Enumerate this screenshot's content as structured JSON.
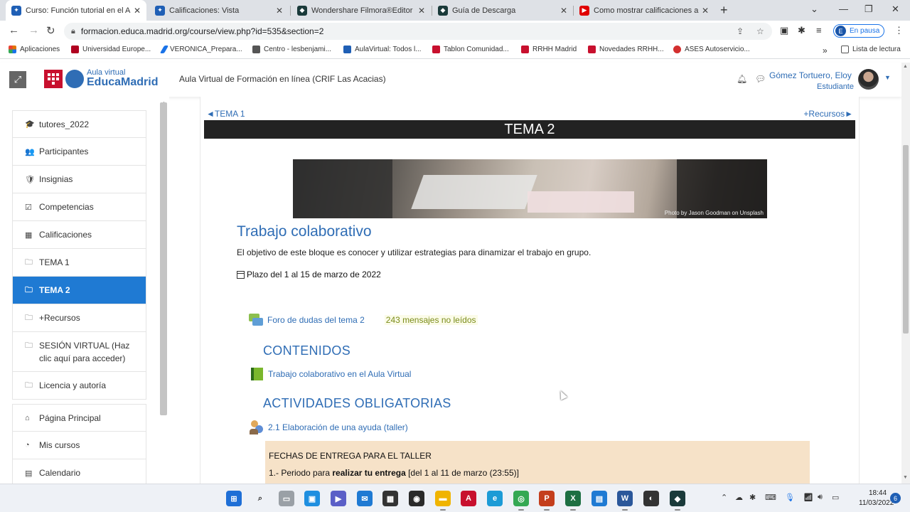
{
  "browser": {
    "tabs": [
      {
        "label": "Curso: Función tutorial en el Aula",
        "color": "#1f5fb5",
        "icon": "moodle-cap-icon",
        "active": true
      },
      {
        "label": "Calificaciones: Vista",
        "color": "#1f5fb5",
        "icon": "moodle-cap-icon",
        "active": false
      },
      {
        "label": "Wondershare Filmora®Editor de",
        "color": "#1a3a3a",
        "icon": "filmora-icon",
        "active": false
      },
      {
        "label": "Guía de Descarga",
        "color": "#1a3a3a",
        "icon": "filmora-icon",
        "active": false
      },
      {
        "label": "Como mostrar calificaciones a lo",
        "color": "#e00000",
        "icon": "youtube-icon",
        "active": false
      }
    ],
    "url": "formacion.educa.madrid.org/course/view.php?id=535&section=2",
    "profile_initial": "E",
    "profile_label": "En pausa",
    "bookmarks": [
      {
        "label": "Aplicaciones",
        "icon": "apps-grid-icon",
        "color": "#e37400"
      },
      {
        "label": "Universidad Europe...",
        "icon": "ue-icon",
        "color": "#b00020"
      },
      {
        "label": "VERONICA_Prepara...",
        "icon": "pen-icon",
        "color": "#1a73e8"
      },
      {
        "label": "Centro - lesbenjami...",
        "icon": "building-icon",
        "color": "#555555"
      },
      {
        "label": "AulaVirtual: Todos l...",
        "icon": "moodle-cap-icon",
        "color": "#1f5fb5"
      },
      {
        "label": "Tablon Comunidad...",
        "icon": "madrid-icon",
        "color": "#c8102e"
      },
      {
        "label": "RRHH Madrid",
        "icon": "madrid-icon",
        "color": "#c8102e"
      },
      {
        "label": "Novedades RRHH...",
        "icon": "madrid-icon",
        "color": "#c8102e"
      },
      {
        "label": "ASES Autoservicio...",
        "icon": "ases-icon",
        "color": "#d32f2f"
      }
    ],
    "more_bookmarks": "»",
    "reading_list": "Lista de lectura"
  },
  "header": {
    "logo_line1": "Aula virtual",
    "logo_line2": "EducaMadrid",
    "site_title": "Aula Virtual de Formación en línea (CRIF Las Acacias)",
    "user_name": "Gómez Tortuero, Eloy",
    "user_role": "Estudiante"
  },
  "sidebar": {
    "items": [
      {
        "label": "tutores_2022",
        "icon": "graduation-cap-icon",
        "glyph": "🎓"
      },
      {
        "label": "Participantes",
        "icon": "users-icon",
        "glyph": "👥"
      },
      {
        "label": "Insignias",
        "icon": "shield-icon",
        "glyph": "🛡"
      },
      {
        "label": "Competencias",
        "icon": "check-square-icon",
        "glyph": "☑"
      },
      {
        "label": "Calificaciones",
        "icon": "table-icon",
        "glyph": "▦"
      },
      {
        "label": "TEMA 1",
        "icon": "folder-icon",
        "glyph": "🗀"
      },
      {
        "label": "TEMA 2",
        "icon": "folder-icon",
        "glyph": "🗀",
        "active": true
      },
      {
        "label": "+Recursos",
        "icon": "folder-icon",
        "glyph": "🗀"
      },
      {
        "label": "SESIÓN VIRTUAL (Haz clic aquí para acceder)",
        "icon": "folder-icon",
        "glyph": "🗀"
      },
      {
        "label": "Licencia y autoría",
        "icon": "folder-icon",
        "glyph": "🗀"
      }
    ],
    "items2": [
      {
        "label": "Página Principal",
        "icon": "home-icon",
        "glyph": "⌂"
      },
      {
        "label": "Mis cursos",
        "icon": "tachometer-icon",
        "glyph": "◔"
      },
      {
        "label": "Calendario",
        "icon": "calendar-icon",
        "glyph": "▤"
      }
    ]
  },
  "main": {
    "prev_link": "◄TEMA 1",
    "next_link": "+Recursos►",
    "section_title": "TEMA 2",
    "banner_credit": "Photo by Jason Goodman on Unsplash",
    "block_title": "Trabajo colaborativo",
    "block_description": "El objetivo de este bloque es conocer y utilizar estrategias para dinamizar el trabajo en grupo.",
    "deadline": "Plazo del 1 al 15 de marzo de 2022",
    "forum_link": "Foro de dudas del tema 2",
    "forum_unread": "243 mensajes no leídos",
    "contenidos_heading": "CONTENIDOS",
    "book_link": "Trabajo colaborativo en el Aula Virtual",
    "actividades_heading": "ACTIVIDADES OBLIGATORIAS",
    "workshop_link": "2.1 Elaboración de una ayuda (taller)",
    "notice_title": "FECHAS DE ENTREGA PARA EL TALLER",
    "notice_line1_prefix": "1.- Periodo para ",
    "notice_line1_bold": "realizar tu entrega",
    "notice_line1_suffix": " [del 1 al 11 de marzo (23:55)]"
  },
  "taskbar": {
    "apps": [
      {
        "name": "windows-start-icon",
        "color": "#1f6fd6",
        "glyph": "⊞"
      },
      {
        "name": "search-icon",
        "color": "#eef1f6",
        "glyph": "⌕"
      },
      {
        "name": "task-view-icon",
        "color": "#9aa0a6",
        "glyph": "▭"
      },
      {
        "name": "widgets-icon",
        "color": "#1f8fe0",
        "glyph": "▣"
      },
      {
        "name": "teams-chat-icon",
        "color": "#5b5fc7",
        "glyph": "▶"
      },
      {
        "name": "mail-icon",
        "color": "#1f7ad3",
        "glyph": "✉"
      },
      {
        "name": "store-icon",
        "color": "#333333",
        "glyph": "▦"
      },
      {
        "name": "obs-icon",
        "color": "#2a2a2a",
        "glyph": "◉"
      },
      {
        "name": "file-explorer-icon",
        "color": "#f0b400",
        "glyph": "▬"
      },
      {
        "name": "acrobat-icon",
        "color": "#c8102e",
        "glyph": "A"
      },
      {
        "name": "edge-icon",
        "color": "#1c9bd6",
        "glyph": "e"
      },
      {
        "name": "chrome-icon",
        "color": "#34a853",
        "glyph": "◎"
      },
      {
        "name": "powerpoint-icon",
        "color": "#c43e1c",
        "glyph": "P"
      },
      {
        "name": "excel-icon",
        "color": "#1d6f42",
        "glyph": "X"
      },
      {
        "name": "calculator-icon",
        "color": "#1f7ad3",
        "glyph": "▤"
      },
      {
        "name": "word-icon",
        "color": "#2b579a",
        "glyph": "W"
      },
      {
        "name": "obs-studio-icon",
        "color": "#333333",
        "glyph": "◐"
      },
      {
        "name": "filmora-icon",
        "color": "#1a3a3a",
        "glyph": "◆"
      }
    ],
    "time": "18:44",
    "date": "11/03/2022",
    "notifications": "6"
  }
}
